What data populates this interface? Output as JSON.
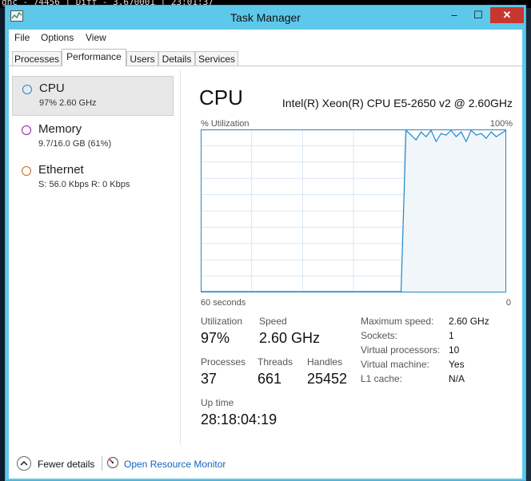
{
  "background": {
    "terminal_text": "gnc - 74456 | Diff - 3.670001 | 23:01:37"
  },
  "window": {
    "title": "Task Manager",
    "controls": {
      "minimize": "–",
      "maximize": "☐",
      "close": "✕"
    }
  },
  "menu": [
    "File",
    "Options",
    "View"
  ],
  "tabs": [
    "Processes",
    "Performance",
    "Users",
    "Details",
    "Services"
  ],
  "active_tab": "Performance",
  "sidebar": [
    {
      "name": "CPU",
      "detail": "97% 2.60 GHz",
      "color": "#1e88c8"
    },
    {
      "name": "Memory",
      "detail": "9.7/16.0 GB (61%)",
      "color": "#8b1fa0"
    },
    {
      "name": "Ethernet",
      "detail": "S: 56.0 Kbps R: 0 Kbps",
      "color": "#c86a1e"
    }
  ],
  "cpu": {
    "title": "CPU",
    "model": "Intel(R) Xeon(R) CPU E5-2650 v2 @ 2.60GHz",
    "graph": {
      "ylabel": "% Utilization",
      "ymax_label": "100%",
      "x_left_label": "60 seconds",
      "x_right_label": "0",
      "line_color": "#1e88c8",
      "fill_color": "#f1f6fb",
      "grid_color": "#d9e7f3",
      "samples": [
        0,
        0,
        0,
        0,
        0,
        0,
        0,
        0,
        0,
        0,
        0,
        0,
        0,
        0,
        0,
        0,
        0,
        0,
        0,
        0,
        0,
        0,
        0,
        0,
        0,
        0,
        0,
        0,
        0,
        0,
        0,
        0,
        0,
        0,
        0,
        0,
        0,
        0,
        0,
        0,
        0,
        100,
        97,
        94,
        99,
        96,
        100,
        93,
        98,
        97,
        100,
        96,
        99,
        93,
        100,
        97,
        98,
        95,
        99,
        96,
        98,
        100
      ]
    },
    "stats": {
      "utilization_label": "Utilization",
      "utilization": "97%",
      "speed_label": "Speed",
      "speed": "2.60 GHz",
      "processes_label": "Processes",
      "processes": "37",
      "threads_label": "Threads",
      "threads": "661",
      "handles_label": "Handles",
      "handles": "25452",
      "uptime_label": "Up time",
      "uptime": "28:18:04:19"
    },
    "specs": [
      {
        "label": "Maximum speed:",
        "value": "2.60 GHz"
      },
      {
        "label": "Sockets:",
        "value": "1"
      },
      {
        "label": "Virtual processors:",
        "value": "10"
      },
      {
        "label": "Virtual machine:",
        "value": "Yes"
      },
      {
        "label": "L1 cache:",
        "value": "N/A"
      }
    ]
  },
  "footer": {
    "fewer_details": "Fewer details",
    "resource_monitor": "Open Resource Monitor"
  }
}
